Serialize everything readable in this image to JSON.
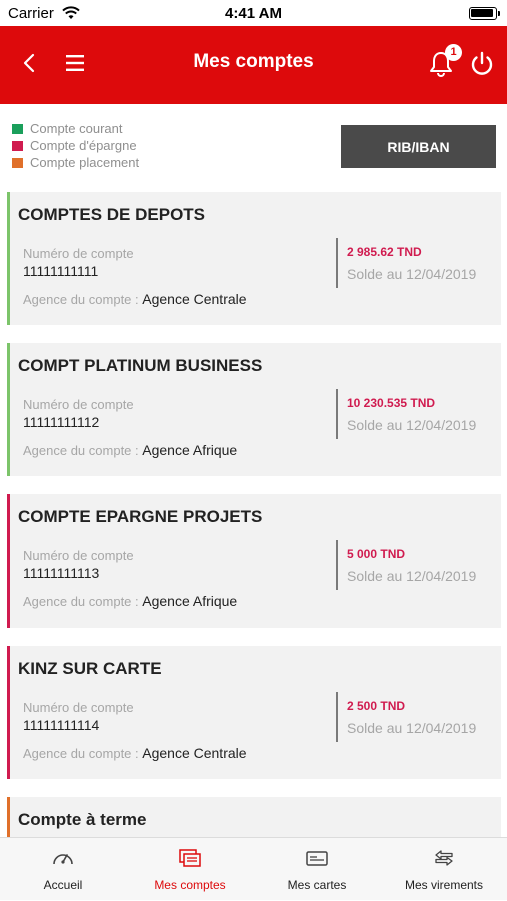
{
  "status_bar": {
    "carrier": "Carrier",
    "time": "4:41 AM"
  },
  "header": {
    "title": "Mes comptes",
    "notification_count": "1"
  },
  "legend": [
    {
      "label": "Compte courant",
      "color": "#1a9f5b"
    },
    {
      "label": "Compte d'épargne",
      "color": "#d01b4f"
    },
    {
      "label": "Compte placement",
      "color": "#e0702a"
    }
  ],
  "rib_button": "RIB/IBAN",
  "account_number_label": "Numéro de compte",
  "agency_label": "Agence du compte : ",
  "accounts": [
    {
      "title": "COMPTES DE DEPOTS",
      "number": "11111111111",
      "agency": "Agence Centrale",
      "amount": "2 985.62 TND",
      "solde": "Solde au 12/04/2019",
      "accent": "#7cc46a"
    },
    {
      "title": "COMPT PLATINUM BUSINESS",
      "number": "11111111112",
      "agency": "Agence Afrique",
      "amount": "10 230.535 TND",
      "solde": "Solde au 12/04/2019",
      "accent": "#7cc46a"
    },
    {
      "title": "COMPTE EPARGNE PROJETS",
      "number": "11111111113",
      "agency": "Agence Afrique",
      "amount": "5 000 TND",
      "solde": "Solde au 12/04/2019",
      "accent": "#d01b4f"
    },
    {
      "title": "KINZ SUR CARTE",
      "number": "11111111114",
      "agency": "Agence Centrale",
      "amount": "2 500 TND",
      "solde": "Solde au 12/04/2019",
      "accent": "#d01b4f"
    },
    {
      "title": "Compte à terme",
      "accent": "#e0702a"
    }
  ],
  "tabs": [
    {
      "label": "Accueil",
      "icon": "gauge-icon",
      "active": false
    },
    {
      "label": "Mes comptes",
      "icon": "accounts-icon",
      "active": true
    },
    {
      "label": "Mes cartes",
      "icon": "card-icon",
      "active": false
    },
    {
      "label": "Mes virements",
      "icon": "transfer-icon",
      "active": false
    }
  ],
  "colors": {
    "brand": "#dd0a0c",
    "amount": "#d01b4f"
  }
}
